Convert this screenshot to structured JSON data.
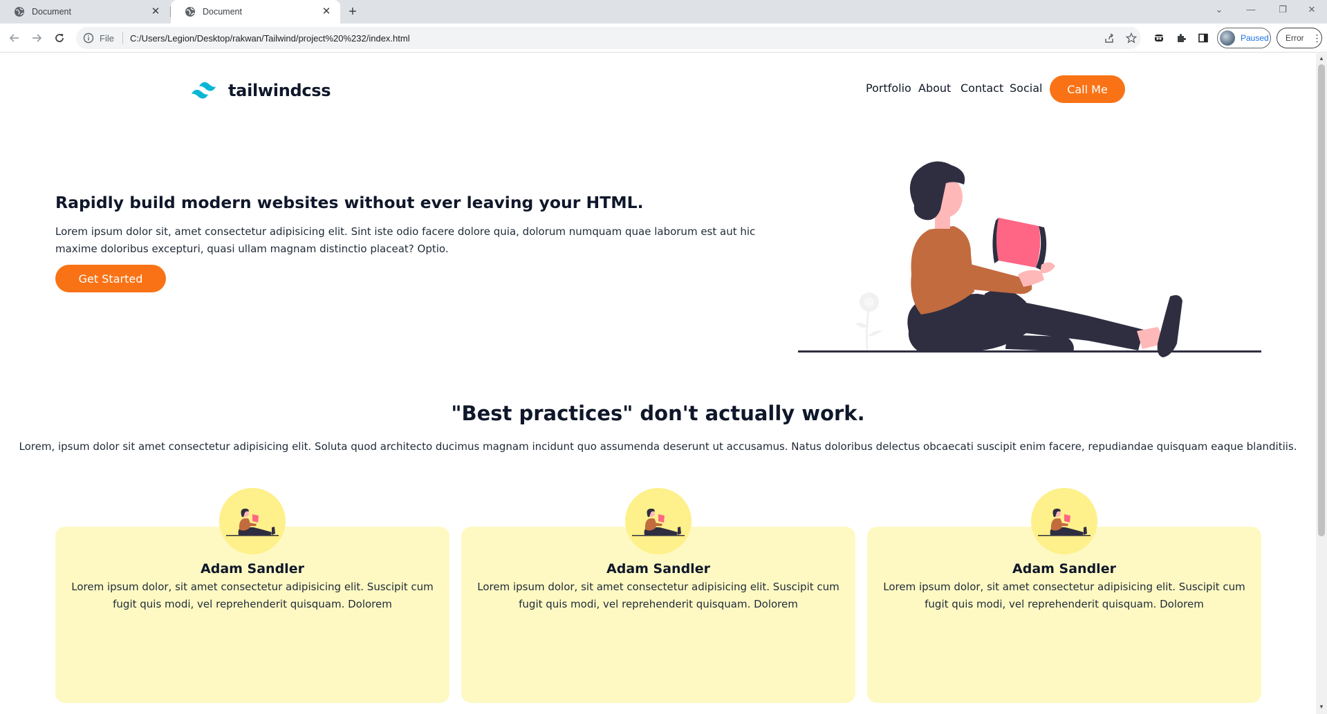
{
  "browser": {
    "tabs": [
      {
        "title": "Document",
        "active": false
      },
      {
        "title": "Document",
        "active": true
      }
    ],
    "address": {
      "scheme_label": "File",
      "url": "C:/Users/Legion/Desktop/rakwan/Tailwind/project%20%232/index.html"
    },
    "profile_label": "Paused",
    "error_label": "Error",
    "icons": [
      "back-arrow-icon",
      "forward-arrow-icon",
      "reload-icon",
      "info-icon",
      "share-icon",
      "star-icon",
      "extension-icon",
      "puzzle-icon",
      "side-panel-icon"
    ]
  },
  "page": {
    "logo_text": "tailwindcss",
    "nav": [
      "Portfolio",
      "About",
      "Contact",
      "Social"
    ],
    "call_button": "Call Me",
    "hero": {
      "title": "Rapidly build modern websites without ever leaving your HTML.",
      "text": "Lorem ipsum dolor sit, amet consectetur adipisicing elit. Sint iste odio facere dolore quia, dolorum numquam quae laborum est aut hic maxime doloribus excepturi, quasi ullam magnam distinctio placeat? Optio.",
      "button": "Get Started"
    },
    "section": {
      "title": "\"Best practices\" don't actually work.",
      "text": "Lorem, ipsum dolor sit amet consectetur adipisicing elit. Soluta quod architecto ducimus magnam incidunt quo assumenda deserunt ut accusamus. Natus doloribus delectus obcaecati suscipit enim facere, repudiandae quisquam eaque blanditiis."
    },
    "cards": [
      {
        "name": "Adam Sandler",
        "text": "Lorem ipsum dolor, sit amet consectetur adipisicing elit. Suscipit cum fugit quis modi, vel reprehenderit quisquam. Dolorem"
      },
      {
        "name": "Adam Sandler",
        "text": "Lorem ipsum dolor, sit amet consectetur adipisicing elit. Suscipit cum fugit quis modi, vel reprehenderit quisquam. Dolorem"
      },
      {
        "name": "Adam Sandler",
        "text": "Lorem ipsum dolor, sit amet consectetur adipisicing elit. Suscipit cum fugit quis modi, vel reprehenderit quisquam. Dolorem"
      }
    ],
    "colors": {
      "accent": "#f97316",
      "card_background": "#fef9c3",
      "avatar_background": "#fef08a",
      "logo_teal": "#06b6d4"
    }
  }
}
